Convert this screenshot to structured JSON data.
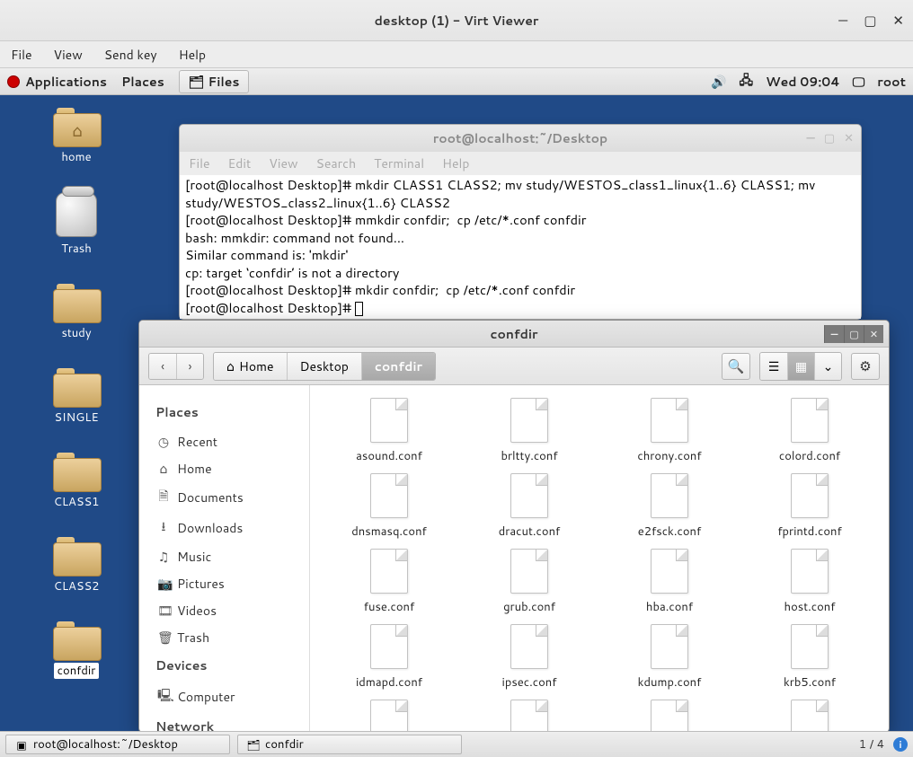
{
  "virt": {
    "title": "desktop (1) - Virt Viewer",
    "menu": {
      "file": "File",
      "view": "View",
      "sendkey": "Send key",
      "help": "Help"
    },
    "btn": {
      "min": "—",
      "max": "▢",
      "close": "✕"
    }
  },
  "panel": {
    "applications": "Applications",
    "places": "Places",
    "files": "Files",
    "clock": "Wed 09:04",
    "user": "root"
  },
  "desktop_icons": [
    {
      "name": "home",
      "label": "home",
      "icon": "folder-home"
    },
    {
      "name": "trash",
      "label": "Trash",
      "icon": "trash"
    },
    {
      "name": "study",
      "label": "study",
      "icon": "folder"
    },
    {
      "name": "single",
      "label": "SINGLE",
      "icon": "folder"
    },
    {
      "name": "class1",
      "label": "CLASS1",
      "icon": "folder"
    },
    {
      "name": "class2",
      "label": "CLASS2",
      "icon": "folder"
    },
    {
      "name": "confdir",
      "label": "confdir",
      "icon": "folder",
      "selected": true
    }
  ],
  "terminal": {
    "title": "root@localhost:~/Desktop",
    "menu": {
      "file": "File",
      "edit": "Edit",
      "view": "View",
      "search": "Search",
      "terminal": "Terminal",
      "help": "Help"
    },
    "lines": [
      "[root@localhost Desktop]# mkdir CLASS1 CLASS2; mv study/WESTOS_class1_linux{1..6} CLASS1; mv study/WESTOS_class2_linux{1..6} CLASS2",
      "[root@localhost Desktop]# mmkdir confdir;  cp /etc/*.conf confdir",
      "bash: mmkdir: command not found...",
      "Similar command is: 'mkdir'",
      "cp: target ‘confdir’ is not a directory",
      "[root@localhost Desktop]# mkdir confdir;  cp /etc/*.conf confdir",
      "[root@localhost Desktop]# "
    ]
  },
  "files": {
    "title": "confdir",
    "crumbs": {
      "home_icon": "⌂",
      "home": "Home",
      "desktop": "Desktop",
      "confdir": "confdir"
    },
    "sidebar": {
      "places": "Places",
      "recent": "Recent",
      "home": "Home",
      "documents": "Documents",
      "downloads": "Downloads",
      "music": "Music",
      "pictures": "Pictures",
      "videos": "Videos",
      "trash": "Trash",
      "devices": "Devices",
      "computer": "Computer",
      "network": "Network"
    },
    "items": [
      "asound.conf",
      "brltty.conf",
      "chrony.conf",
      "colord.conf",
      "dnsmasq.conf",
      "dracut.conf",
      "e2fsck.conf",
      "fprintd.conf",
      "fuse.conf",
      "grub.conf",
      "hba.conf",
      "host.conf",
      "idmapd.conf",
      "ipsec.conf",
      "kdump.conf",
      "krb5.conf",
      "",
      "",
      "",
      ""
    ]
  },
  "bottom": {
    "task1": "root@localhost:~/Desktop",
    "task2": "confdir",
    "workspace": "1 / 4"
  }
}
